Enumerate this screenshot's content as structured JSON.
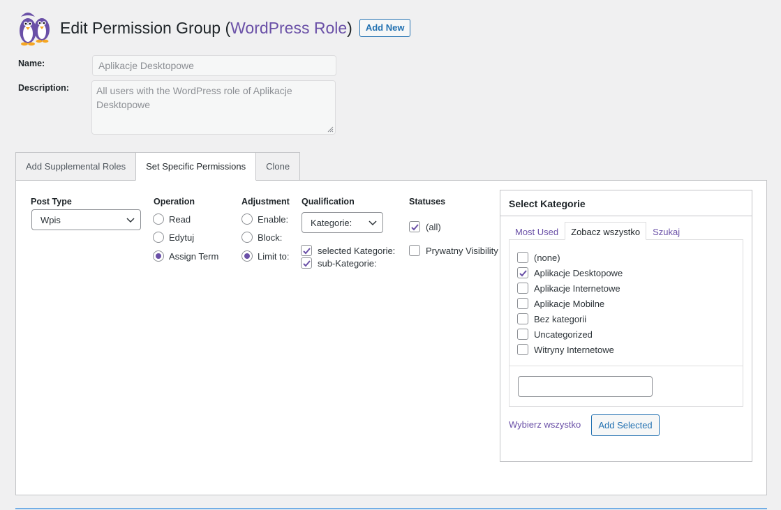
{
  "header": {
    "title_prefix": "Edit Permission Group (",
    "title_link": "WordPress Role",
    "title_suffix": ")",
    "add_new_label": "Add New",
    "logo_icon": "penguins-logo-icon"
  },
  "form": {
    "name_label": "Name:",
    "name_value": "Aplikacje Desktopowe",
    "description_label": "Description:",
    "description_value": "All users with the WordPress role of Aplikacje Desktopowe"
  },
  "tabs": [
    "Add Supplemental Roles",
    "Set Specific Permissions",
    "Clone"
  ],
  "active_tab": "Set Specific Permissions",
  "permissions": {
    "post_type": {
      "heading": "Post Type",
      "selected": "Wpis"
    },
    "operation": {
      "heading": "Operation",
      "options": [
        {
          "label": "Read",
          "selected": false
        },
        {
          "label": "Edytuj",
          "selected": false
        },
        {
          "label": "Assign Term",
          "selected": true
        }
      ]
    },
    "adjustment": {
      "heading": "Adjustment",
      "options": [
        {
          "label": "Enable:",
          "selected": false
        },
        {
          "label": "Block:",
          "selected": false
        },
        {
          "label": "Limit to:",
          "selected": true
        }
      ]
    },
    "qualification": {
      "heading": "Qualification",
      "selected": "Kategorie:",
      "checks": [
        {
          "label": "selected Kategorie:",
          "checked": true
        },
        {
          "label": "sub-Kategorie:",
          "checked": true
        }
      ]
    },
    "statuses": {
      "heading": "Statuses",
      "checks": [
        {
          "label": "(all)",
          "checked": true
        },
        {
          "label": "Prywatny Visibility",
          "checked": false
        }
      ]
    }
  },
  "select_box": {
    "title": "Select Kategorie",
    "tabs": [
      "Most Used",
      "Zobacz wszystko",
      "Szukaj"
    ],
    "active_tab": "Zobacz wszystko",
    "categories": [
      {
        "label": "(none)",
        "checked": false
      },
      {
        "label": "Aplikacje Desktopowe",
        "checked": true
      },
      {
        "label": "Aplikacje Internetowe",
        "checked": false
      },
      {
        "label": "Aplikacje Mobilne",
        "checked": false
      },
      {
        "label": "Bez kategorii",
        "checked": false
      },
      {
        "label": "Uncategorized",
        "checked": false
      },
      {
        "label": "Witryny Internetowe",
        "checked": false
      }
    ],
    "search_value": "",
    "select_all_label": "Wybierz wszystko",
    "add_selected_label": "Add Selected"
  },
  "colors": {
    "accent": "#6a50a7",
    "button_blue": "#2271b1",
    "background": "#f0f0f1"
  }
}
